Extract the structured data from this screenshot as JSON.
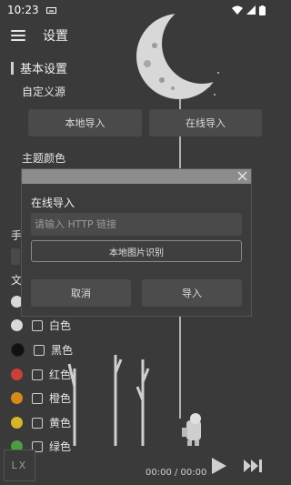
{
  "status_bar": {
    "time": "10:23"
  },
  "header": {
    "title": "设置"
  },
  "section": {
    "title": "基本设置"
  },
  "source": {
    "label": "自定义源",
    "local_import_label": "本地导入",
    "online_import_label": "在线导入"
  },
  "theme": {
    "label": "主题颜色",
    "partial_label_1": "手",
    "partial_label_2": "文",
    "colors": [
      {
        "name": "白色",
        "color": "#d9d9d9"
      },
      {
        "name": "黑色",
        "color": "#111111"
      },
      {
        "name": "红色",
        "color": "#c9403a"
      },
      {
        "name": "橙色",
        "color": "#d9881c"
      },
      {
        "name": "黄色",
        "color": "#d6b52a"
      },
      {
        "name": "绿色",
        "color": "#4f9a45"
      }
    ]
  },
  "dialog": {
    "title": "在线导入",
    "input_placeholder": "请输入 HTTP 链接",
    "image_recognition_label": "本地图片识别",
    "cancel_label": "取消",
    "import_label": "导入"
  },
  "player": {
    "logo_text": "LX",
    "time": "00:00 / 00:00"
  },
  "colors": {
    "background": "#3a3a3a",
    "button": "#4a4a4a",
    "dialog_header": "#8c8c8c"
  },
  "icons": [
    "menu-icon",
    "close-icon",
    "play-icon",
    "next-icon",
    "wifi-icon",
    "battery-icon",
    "signal-icon"
  ]
}
